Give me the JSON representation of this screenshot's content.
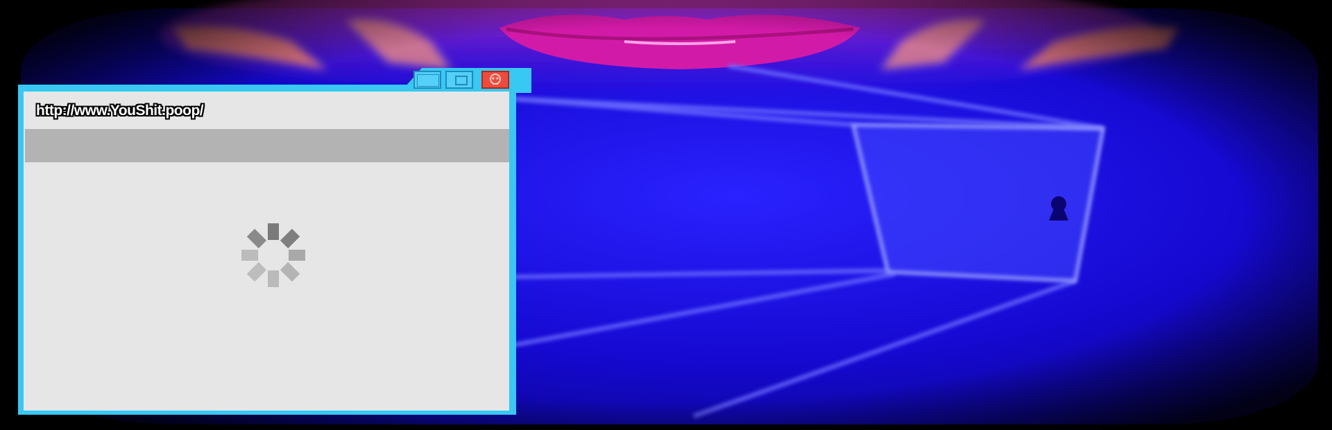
{
  "browser": {
    "url": "http://www.YouShit.poop/",
    "buttons": {
      "maximize_icon": "window-panel-icon",
      "restore_icon": "restore-icon",
      "close_icon": "skull-close-icon"
    },
    "loading_icon": "loading-spinner-icon"
  },
  "background": {
    "lips_icon": "lips-icon",
    "keyhole_icon": "keyhole-icon"
  },
  "colors": {
    "window_frame": "#37c8f4",
    "close_button": "#f04a3c",
    "window_body": "#e6e6e6",
    "tab_bar": "#b3b3b3",
    "background_blue": "#1a0fd8",
    "lips_magenta": "#d21aa8"
  }
}
